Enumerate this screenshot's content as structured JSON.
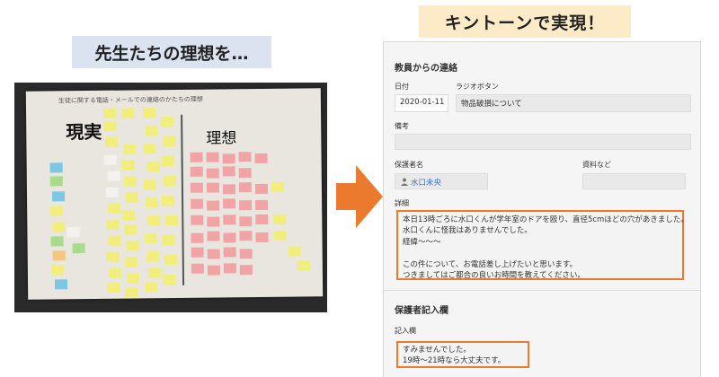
{
  "captions": {
    "left": "先生たちの理想を…",
    "right": "キントーンで実現！"
  },
  "photo": {
    "header": "生徒に関する電話・メールでの連絡のかたちの理想",
    "label_left": "現実",
    "label_right": "理想"
  },
  "colors": {
    "accent_orange": "#ec7a2e",
    "left_caption_bg": "#dbe3f0",
    "right_caption_bg": "#fcebc6",
    "link_blue": "#3573c4"
  },
  "form": {
    "section1_title": "教員からの連絡",
    "date_label": "日付",
    "date_value": "2020-01-11",
    "radio_label": "ラジオボタン",
    "radio_value": "物品破損について",
    "remarks_label": "備考",
    "guardian_label": "保護者名",
    "guardian_value": "水口未央",
    "materials_label": "資料など",
    "details_label": "詳細",
    "details_lines": [
      "本日13時ごろに水口くんが学年室のドアを殴り、直径5cmほどの穴があきました。",
      "水口くんに怪我はありませんでした。",
      "経緯〜〜〜",
      "",
      "この件について、お電話差し上げたいと思います。",
      "つきましてはご都合の良いお時間を教えてください。"
    ],
    "section2_title": "保護者記入欄",
    "entry_label": "記入欄",
    "entry_lines": [
      "すみませんでした。",
      "19時〜21時なら大丈夫です。"
    ]
  }
}
